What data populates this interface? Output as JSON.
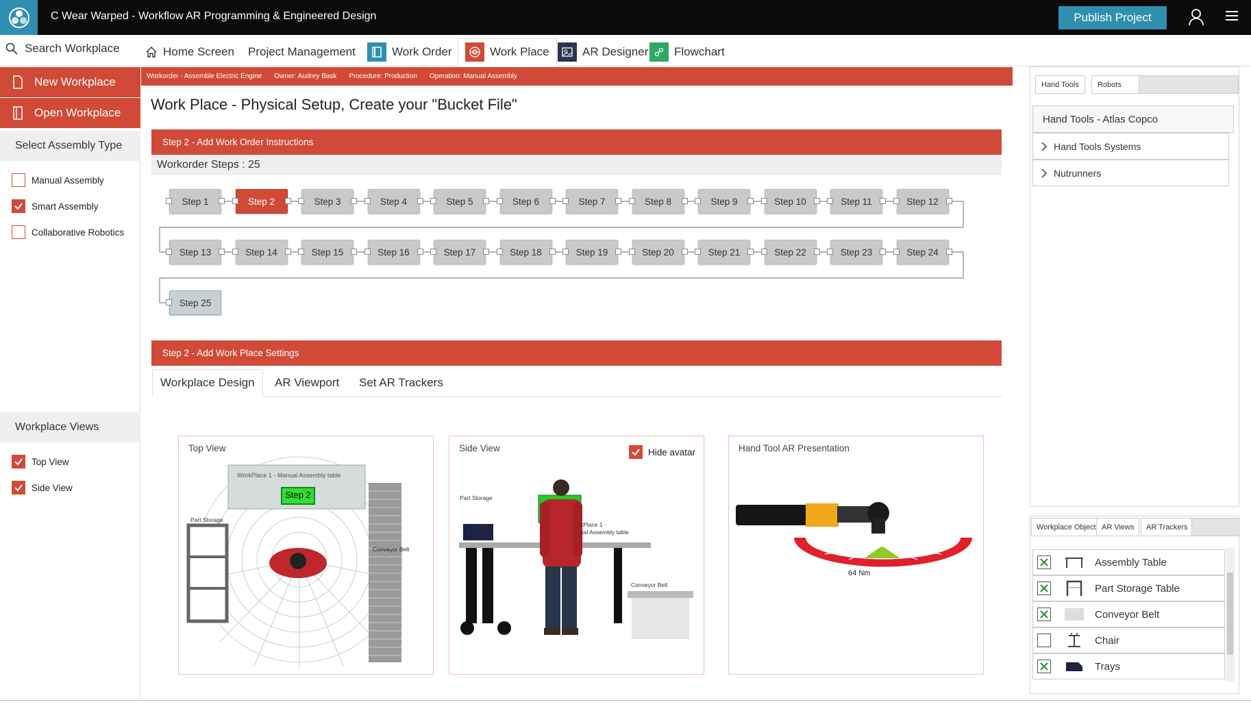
{
  "app": {
    "title": "C Wear Warped - Workflow AR Programming & Engineered Design",
    "publish_label": "Publish Project"
  },
  "nav": {
    "search_label": "Search Workplace",
    "items": [
      {
        "label": "Home Screen",
        "icon": "home-icon"
      },
      {
        "label": "Project Management",
        "icon": ""
      },
      {
        "label": "Work Order",
        "icon": "workorder-icon",
        "color": "#2f8fb0"
      },
      {
        "label": "Work Place",
        "icon": "workplace-icon",
        "color": "#d14a37"
      },
      {
        "label": "AR Designer",
        "icon": "ar-designer-icon",
        "color": "#2b3550"
      },
      {
        "label": "Flowchart",
        "icon": "flowchart-icon",
        "color": "#2fa863"
      }
    ]
  },
  "sidebar": {
    "new_label": "New Workplace",
    "open_label": "Open Workplace",
    "assembly_header": "Select Assembly Type",
    "assembly_types": [
      {
        "label": "Manual Assembly",
        "checked": false
      },
      {
        "label": "Smart Assembly",
        "checked": true
      },
      {
        "label": "Collaborative Robotics",
        "checked": false
      }
    ],
    "views_header": "Workplace Views",
    "views": [
      {
        "label": "Top View",
        "checked": true
      },
      {
        "label": "Side View",
        "checked": true
      }
    ]
  },
  "infobar": {
    "workorder": "Workorder - Assemble Electric Engine",
    "owner": "Owner: Audrey Bask",
    "procedure": "Procedure: Production",
    "operation": "Operation: Manual Assembly"
  },
  "page": {
    "title": "Work Place - Physical Setup, Create your \"Bucket File\"",
    "section1": "Step 2 - Add Work Order Instructions",
    "steps_count_label": "Workorder Steps : 25",
    "active_step": 2,
    "steps": [
      "Step 1",
      "Step 2",
      "Step 3",
      "Step 4",
      "Step 5",
      "Step 6",
      "Step 7",
      "Step 8",
      "Step 9",
      "Step 10",
      "Step 11",
      "Step 12",
      "Step 13",
      "Step 14",
      "Step 15",
      "Step 16",
      "Step 17",
      "Step 18",
      "Step 19",
      "Step 20",
      "Step 21",
      "Step 22",
      "Step 23",
      "Step 24",
      "Step 25"
    ],
    "section2": "Step 2 - Add Work Place Settings",
    "tabs": [
      "Workplace Design",
      "AR Viewport",
      "Set AR Trackers"
    ],
    "active_tab": "Workplace Design"
  },
  "views": {
    "top": {
      "label": "Top View",
      "table_label": "WorkPlace 1 - Manual Assembly table",
      "step_badge": "Step 2",
      "storage_label": "Part Storage",
      "belt_label": "Conveyor Belt"
    },
    "side": {
      "label": "Side View",
      "hide_avatar_label": "Hide avatar",
      "hide_avatar_checked": true,
      "storage_label": "Part Storage",
      "table_label_1": "kPlace 1 -",
      "table_label_2": "ual Assembly table",
      "belt_label": "Conveyor Belt"
    },
    "tool": {
      "label": "Hand Tool AR Presentation",
      "torque_label": "64 Nm"
    }
  },
  "right": {
    "tabs": [
      "Hand Tools",
      "Robots"
    ],
    "group_label": "Hand Tools - Atlas Copco",
    "rows": [
      "Hand Tools Systems",
      "Nutrunners"
    ]
  },
  "objects": {
    "tabs": [
      "Workplace Object",
      "AR Views",
      "AR Trackers"
    ],
    "items": [
      {
        "label": "Assembly Table",
        "checked": true,
        "icon": "assembly-table-icon"
      },
      {
        "label": "Part Storage Table",
        "checked": true,
        "icon": "part-storage-table-icon"
      },
      {
        "label": "Conveyor Belt",
        "checked": true,
        "icon": "conveyor-belt-icon"
      },
      {
        "label": "Chair",
        "checked": false,
        "icon": "chair-icon"
      },
      {
        "label": "Trays",
        "checked": true,
        "icon": "trays-icon"
      }
    ]
  },
  "colors": {
    "accent": "#d14a37",
    "brand": "#2f8fb0",
    "header": "#0a0a0a"
  }
}
